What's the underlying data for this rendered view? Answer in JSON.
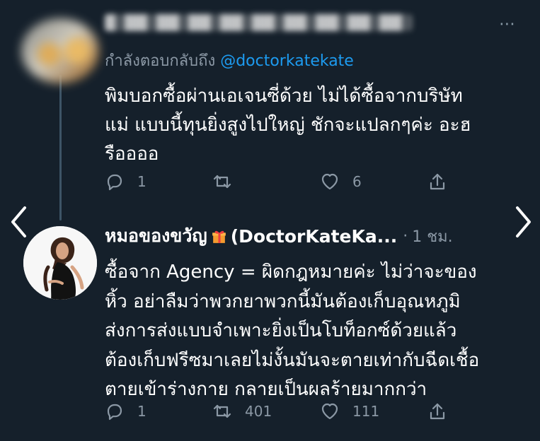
{
  "tweet1": {
    "blurred_author": "",
    "reply_prefix": "กำลังตอบกลับถึง",
    "mention": "@doctorkatekate",
    "text": "พิมบอกซื้อผ่านเอเจนซี่ด้วย ไม่ได้ซื้อจากบริษัท\nแม่ แบบนี้ทุนยิ่งสูงไปใหญ่ ชักจะแปลกๆค่ะ อะฮ\nรืออออ",
    "actions": {
      "reply_count": "1",
      "retweet_count": "",
      "like_count": "6",
      "share_count": ""
    }
  },
  "tweet2": {
    "display_name": "หมอของขวัญ",
    "display_name_suffix": "(DoctorKateKa...",
    "separator": "·",
    "time": "1 ชม.",
    "text": "ซื้อจาก Agency = ผิดกฎหมายค่ะ ไม่ว่าจะของ\nหิ้ว อย่าลืมว่าพวกยาพวกนี้มันต้องเก็บอุณหภูมิ\nส่งการส่งแบบจำเพาะยิ่งเป็นโบท็อกซ์ด้วยแล้ว\nต้องเก็บฟรีซมาเลยไม่งั้นมันจะตายเท่ากับฉีดเชื้อ\nตายเข้าร่างกาย กลายเป็นผลร้ายมากกว่า",
    "actions": {
      "reply_count": "1",
      "retweet_count": "401",
      "like_count": "111",
      "share_count": ""
    }
  },
  "ui": {
    "more_label": "⋯",
    "nav_left_icon": "chevron-left-icon",
    "nav_right_icon": "chevron-right-icon",
    "colors": {
      "background": "#15202b",
      "text": "#ffffff",
      "muted": "#8b98a5",
      "link": "#1d9bf0",
      "thread_line": "#3d5466"
    }
  }
}
